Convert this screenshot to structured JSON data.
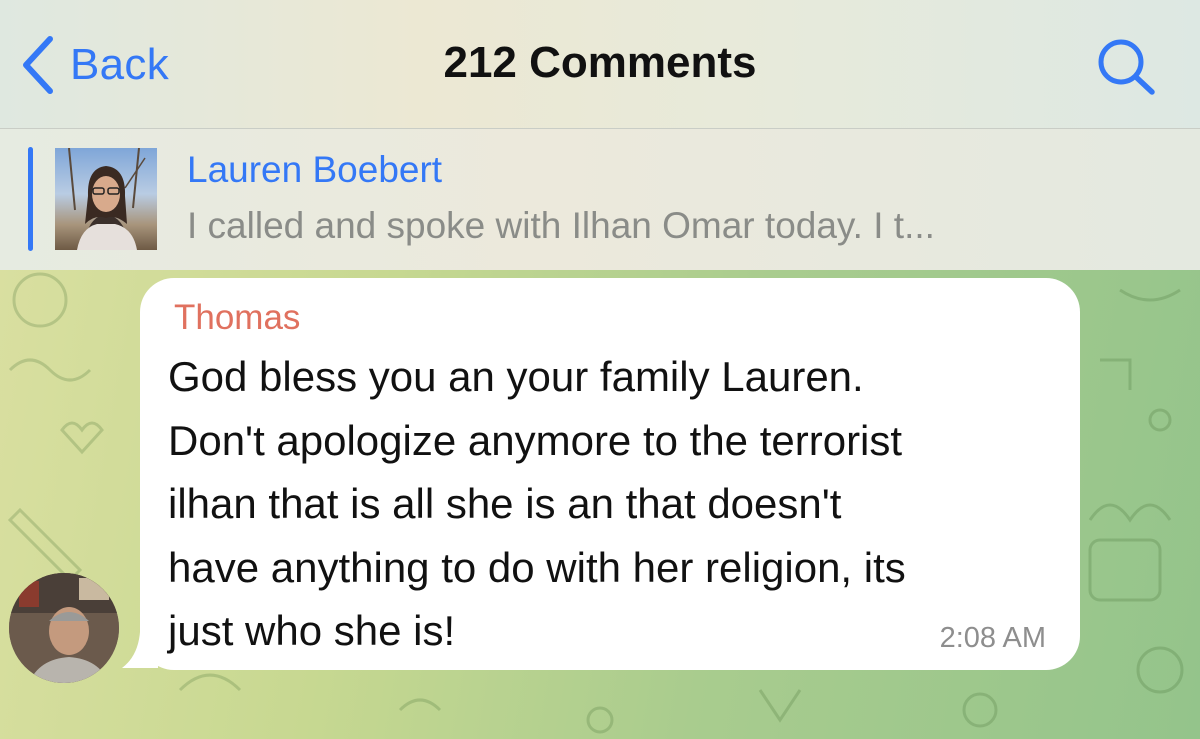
{
  "header": {
    "back_label": "Back",
    "title": "212 Comments",
    "back_icon": "chevron-left-icon",
    "search_icon": "search-icon"
  },
  "pinned": {
    "name": "Lauren Boebert",
    "preview": "I called and spoke with Ilhan Omar today. I t..."
  },
  "message": {
    "sender": "Thomas",
    "text": "God bless you an your family Lauren.\nDon't apologize anymore to the terrorist\nilhan that is all she is an that doesn't\nhave anything to do with her religion, its\njust who she is!",
    "time": "2:08 AM"
  },
  "colors": {
    "accent": "#3478f6",
    "sender_name": "#e0715f",
    "timestamp": "#8e8e8e"
  }
}
